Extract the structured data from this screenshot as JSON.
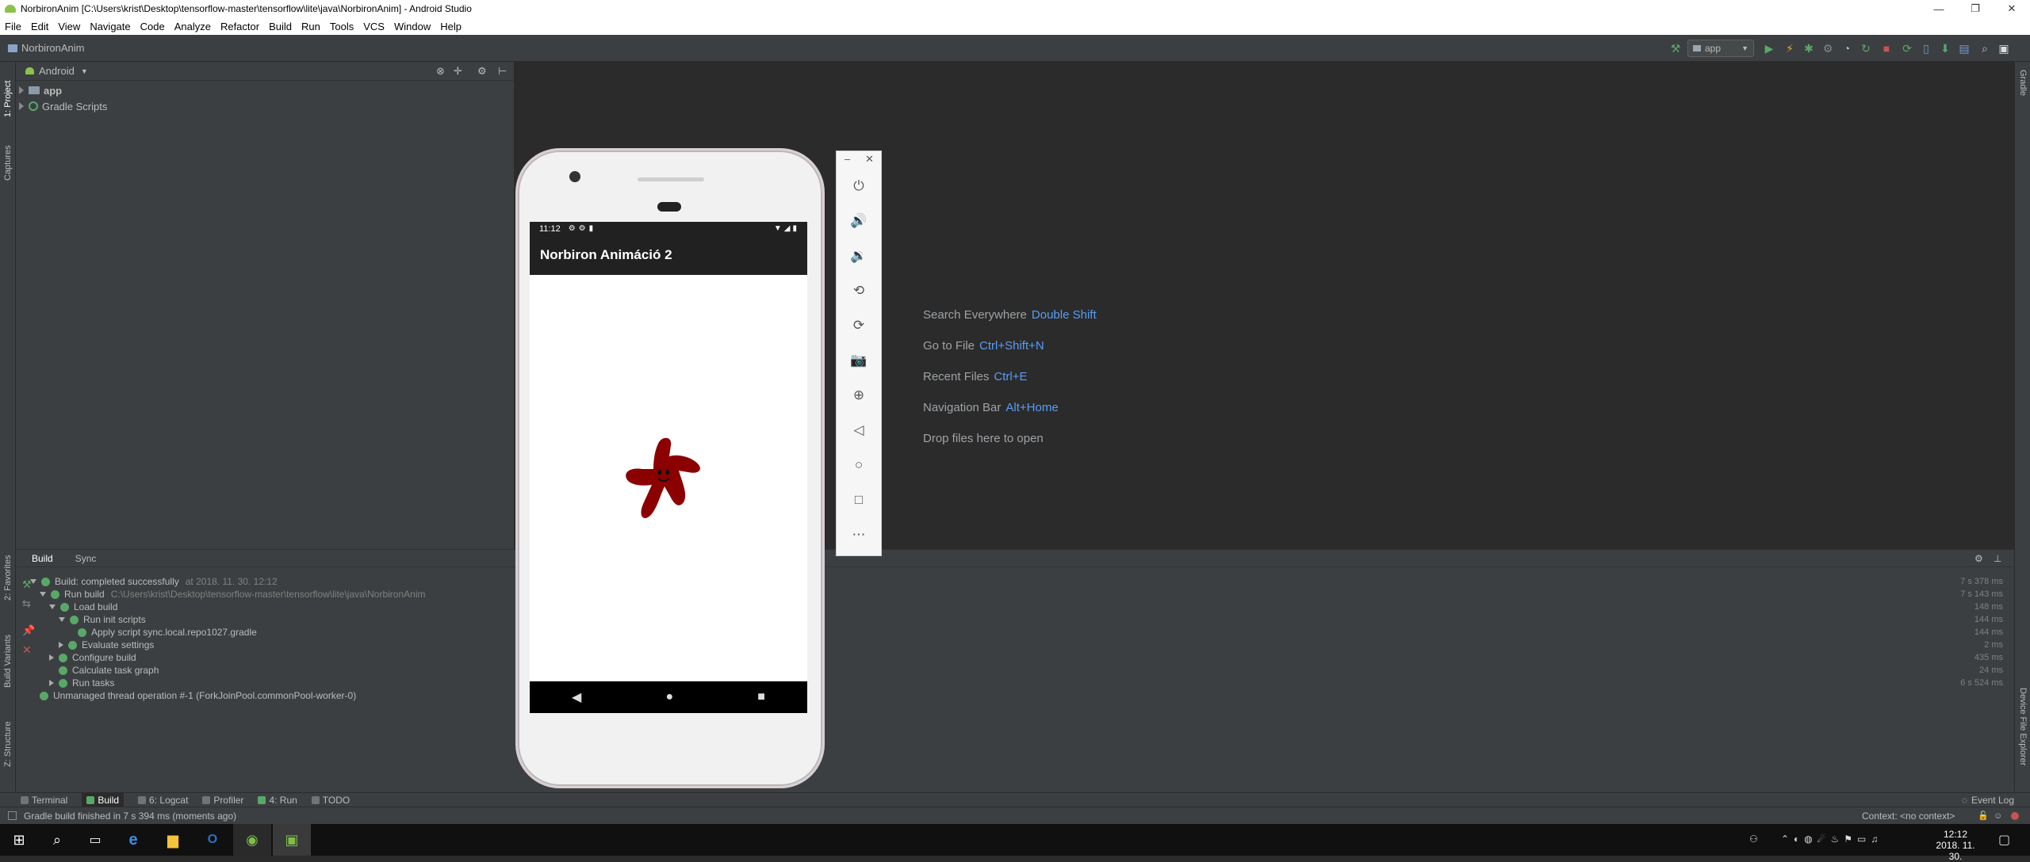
{
  "window": {
    "title": "NorbironAnim [C:\\Users\\krist\\Desktop\\tensorflow-master\\tensorflow\\lite\\java\\NorbironAnim] - Android Studio"
  },
  "menu": [
    "File",
    "Edit",
    "View",
    "Navigate",
    "Code",
    "Analyze",
    "Refactor",
    "Build",
    "Run",
    "Tools",
    "VCS",
    "Window",
    "Help"
  ],
  "navbar": {
    "breadcrumb": "NorbironAnim",
    "run_config": "app"
  },
  "side_tabs": {
    "left": [
      "1: Project",
      "Captures",
      "2: Favorites",
      "Build Variants",
      "Z: Structure"
    ],
    "right": [
      "Gradle",
      "Device File Explorer"
    ]
  },
  "project": {
    "view_mode": "Android",
    "tree": [
      "app",
      "Gradle Scripts"
    ]
  },
  "editor_hints": [
    {
      "label": "Search Everywhere",
      "key": "Double Shift"
    },
    {
      "label": "Go to File",
      "key": "Ctrl+Shift+N"
    },
    {
      "label": "Recent Files",
      "key": "Ctrl+E"
    },
    {
      "label": "Navigation Bar",
      "key": "Alt+Home"
    },
    {
      "label": "Drop files here to open",
      "key": ""
    }
  ],
  "build": {
    "tabs": [
      "Build",
      "Sync"
    ],
    "rows": [
      {
        "text": "Build: completed successfully",
        "note": "at 2018. 11. 30. 12:12",
        "time": "7 s 378 ms"
      },
      {
        "text": "Run build",
        "note": "C:\\Users\\krist\\Desktop\\tensorflow-master\\tensorflow\\lite\\java\\NorbironAnim",
        "time": "7 s 143 ms"
      },
      {
        "text": "Load build",
        "note": "",
        "time": "148 ms"
      },
      {
        "text": "Run init scripts",
        "note": "",
        "time": "144 ms"
      },
      {
        "text": "Apply script sync.local.repo1027.gradle",
        "note": "",
        "time": "144 ms"
      },
      {
        "text": "Evaluate settings",
        "note": "",
        "time": "2 ms"
      },
      {
        "text": "Configure build",
        "note": "",
        "time": "435 ms"
      },
      {
        "text": "Calculate task graph",
        "note": "",
        "time": "24 ms"
      },
      {
        "text": "Run tasks",
        "note": "",
        "time": "6 s 524 ms"
      },
      {
        "text": "Unmanaged thread operation #-1 (ForkJoinPool.commonPool-worker-0)",
        "note": "",
        "time": ""
      }
    ]
  },
  "bottom_tabs": [
    "Terminal",
    "Build",
    "6: Logcat",
    "Profiler",
    "4: Run",
    "TODO"
  ],
  "event_log": "Event Log",
  "status": {
    "message": "Gradle build finished in 7 s 394 ms (moments ago)",
    "context": "Context: <no context>"
  },
  "phone": {
    "time": "11:12",
    "app_title": "Norbiron Animáció 2",
    "star_color": "#8b0000"
  },
  "emulator_tools": [
    "power-icon",
    "volume-up-icon",
    "volume-down-icon",
    "rotate-left-icon",
    "rotate-right-icon",
    "camera-icon",
    "zoom-icon",
    "back-icon",
    "home-icon",
    "overview-icon",
    "more-icon"
  ],
  "taskbar": {
    "time": "12:12",
    "date": "2018. 11. 30."
  }
}
